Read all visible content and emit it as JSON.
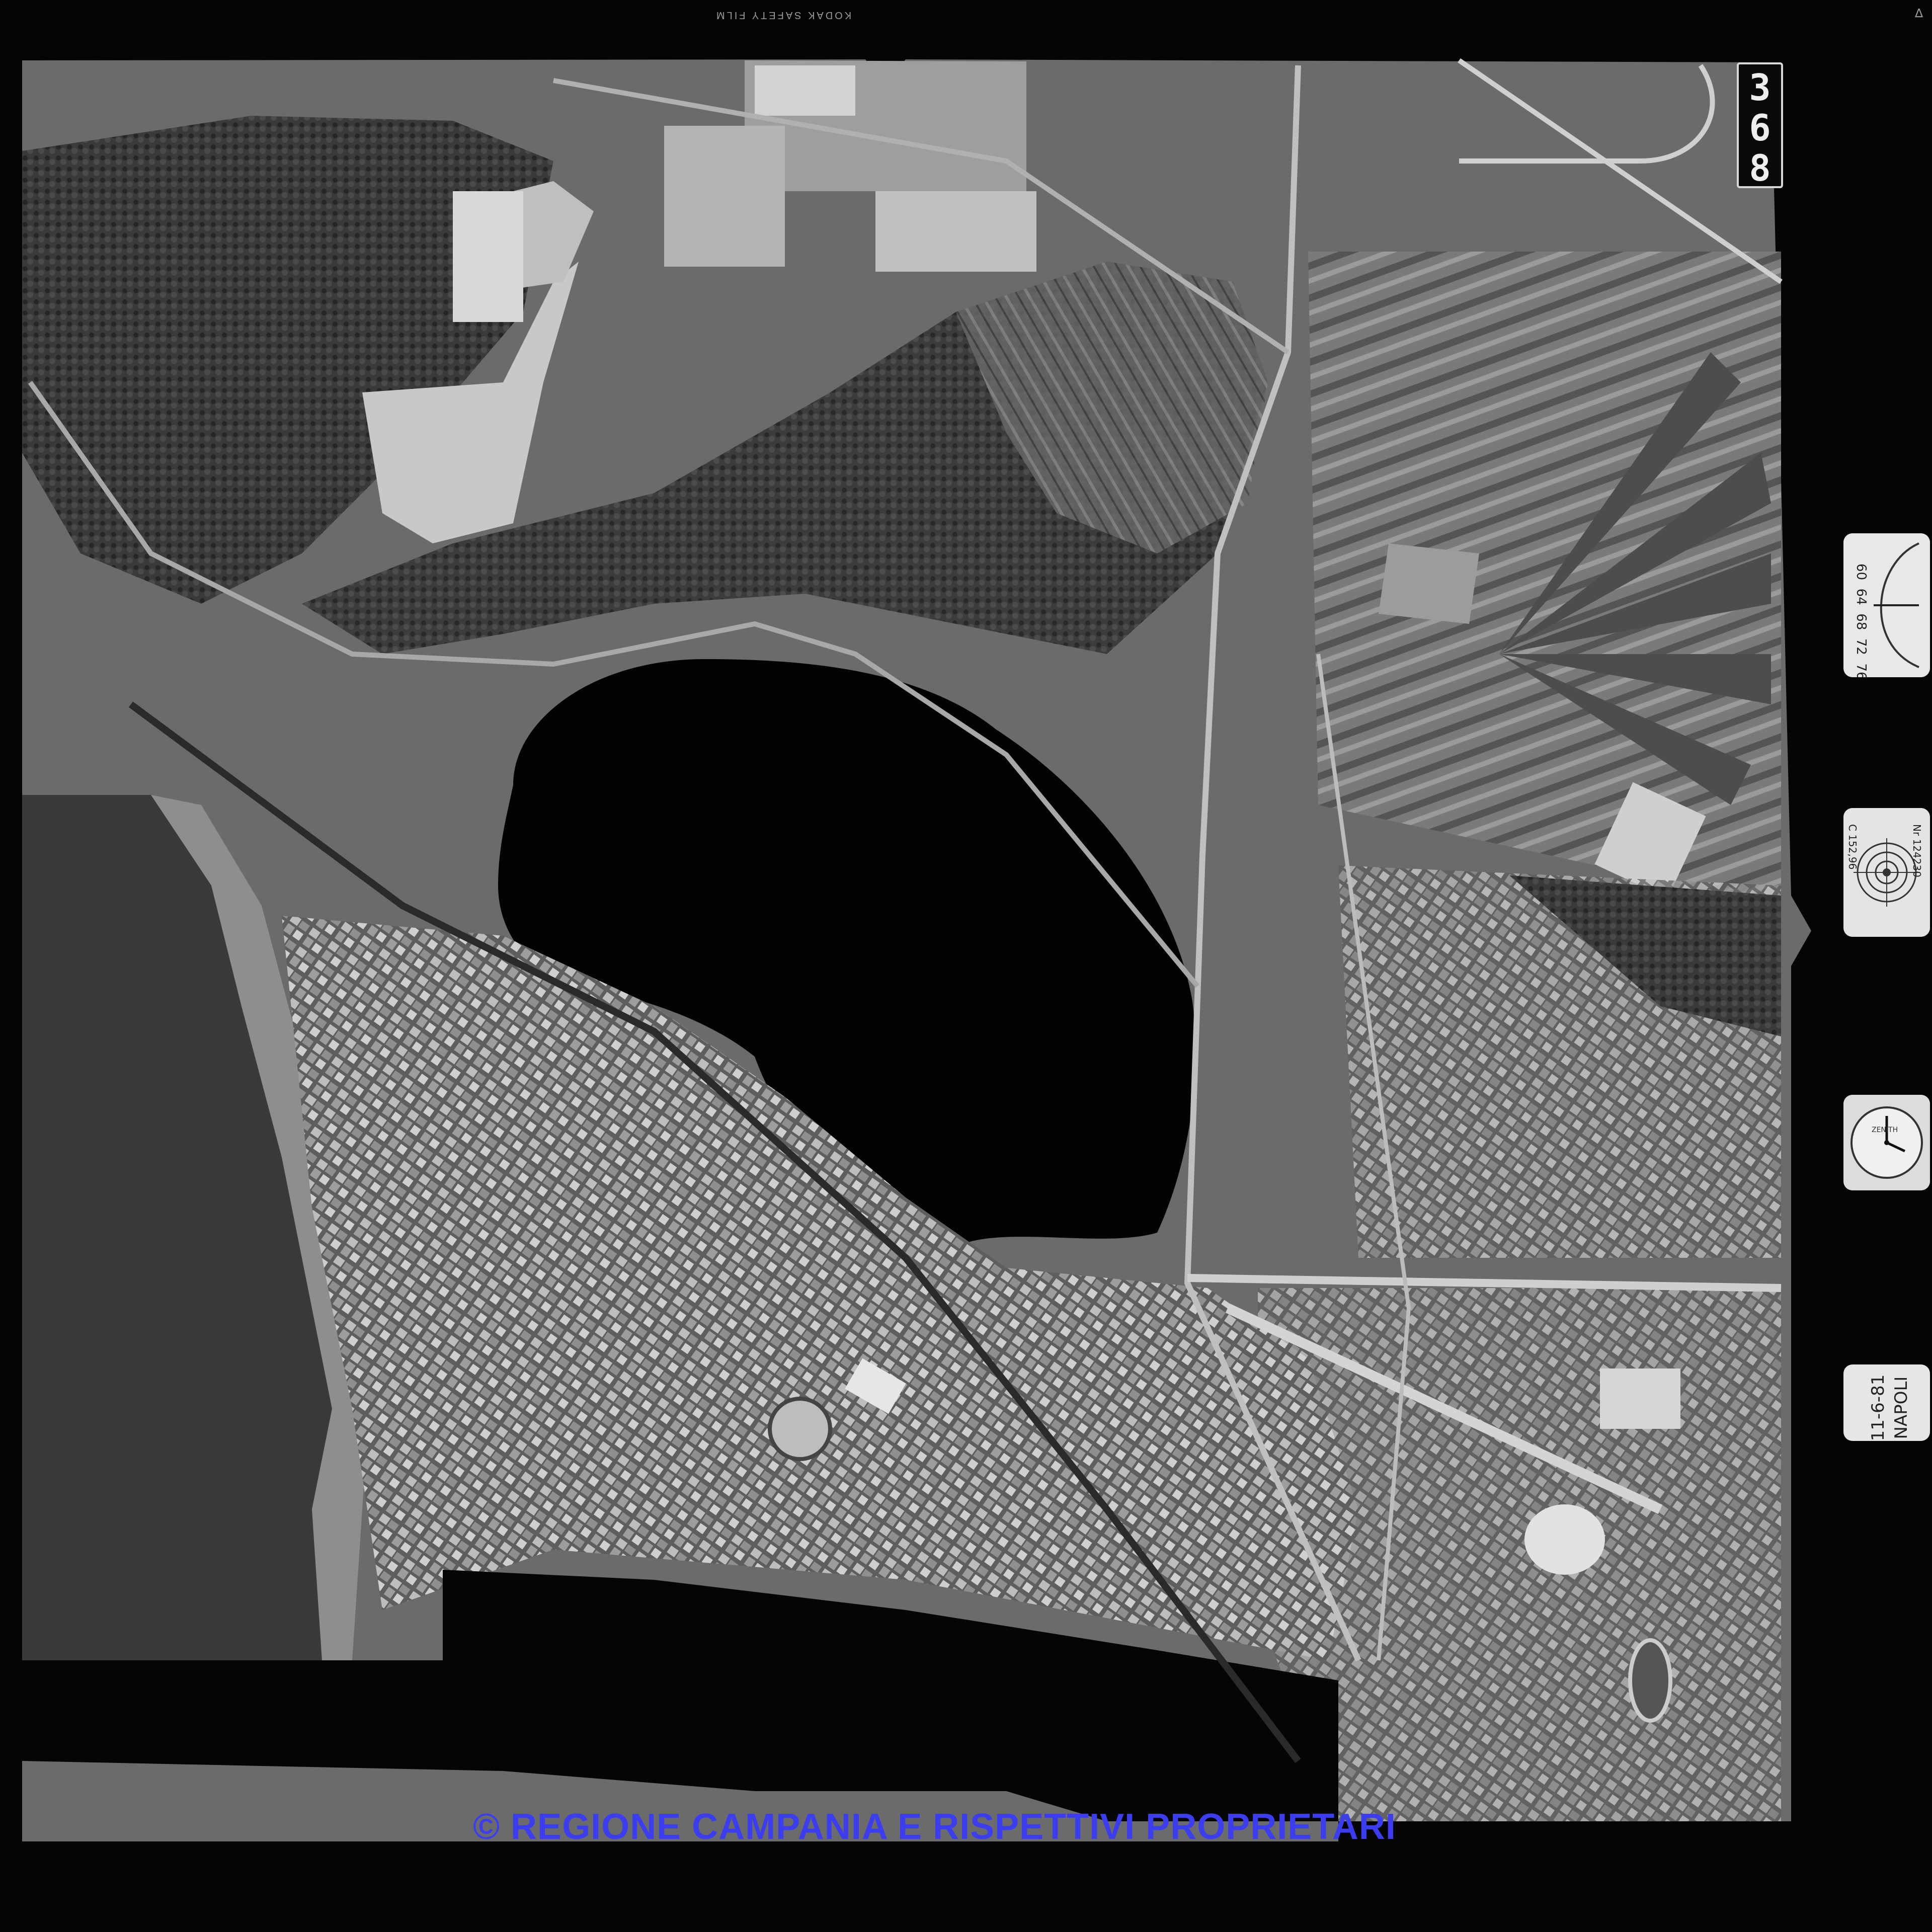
{
  "film_edge": {
    "brand_text": "KODAK SAFETY FILM",
    "corner_mark": "∇"
  },
  "frame_number_digits": [
    "3",
    "6",
    "8"
  ],
  "instruments": {
    "altimeter_scale": [
      "60",
      "64",
      "68",
      "72",
      "76"
    ],
    "lens_serial": "Nr 124230",
    "focal_length": "C 152,96",
    "watch_brand": "ZENITH",
    "date_card": {
      "line1": "11-6-81",
      "line2": "NAPOLI"
    }
  },
  "watermark": "© REGIONE CAMPANIA E RISPETTIVI PROPRIETARI",
  "colors": {
    "watermark": "#3d3df0",
    "film_border": "#050505"
  },
  "icons": {
    "altimeter": "altimeter-dial-icon",
    "level": "bubble-level-icon",
    "watch": "wristwatch-icon"
  }
}
